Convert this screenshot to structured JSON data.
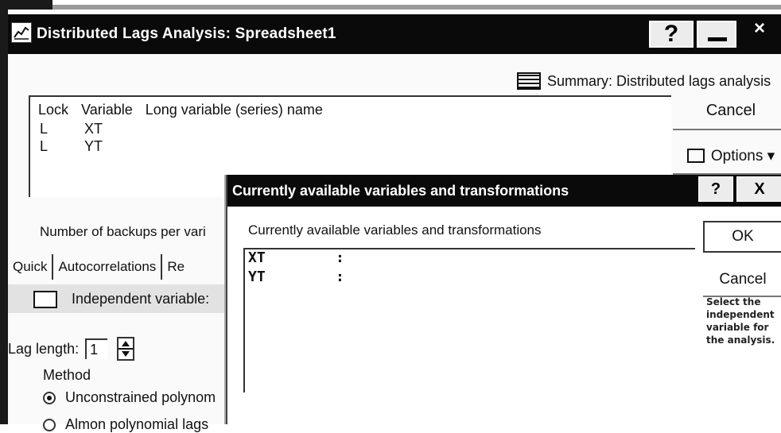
{
  "main_window": {
    "title": "Distributed Lags Analysis: Spreadsheet1",
    "help_label": "?",
    "close_label": "×",
    "summary_label": "Summary:  Distributed lags analysis",
    "cancel_label": "Cancel",
    "options_label": "Options ▾",
    "var_list": {
      "headers": [
        "Lock",
        "Variable",
        "Long variable (series) name"
      ],
      "rows": [
        {
          "lock": "L",
          "variable": "XT"
        },
        {
          "lock": "L",
          "variable": "YT"
        }
      ]
    },
    "backups_label": "Number of backups per vari",
    "tabs": [
      "Quick",
      "Autocorrelations",
      "Re"
    ],
    "independent_label": "Independent variable:",
    "lag_length_label": "Lag length:",
    "lag_length_value": "1",
    "method_label": "Method",
    "radios": [
      {
        "label": "Unconstrained polynom",
        "selected": true
      },
      {
        "label": "Almon polynomial lags",
        "selected": false
      }
    ]
  },
  "dialog": {
    "title": "Currently available variables and transformations",
    "help_label": "?",
    "close_label": "X",
    "list_label": "Currently available variables and transformations",
    "items": [
      {
        "name": "XT",
        "sep": ":"
      },
      {
        "name": "YT",
        "sep": ":"
      }
    ],
    "ok_label": "OK",
    "cancel_label": "Cancel",
    "help_text": "Select the independent variable for the analysis."
  }
}
